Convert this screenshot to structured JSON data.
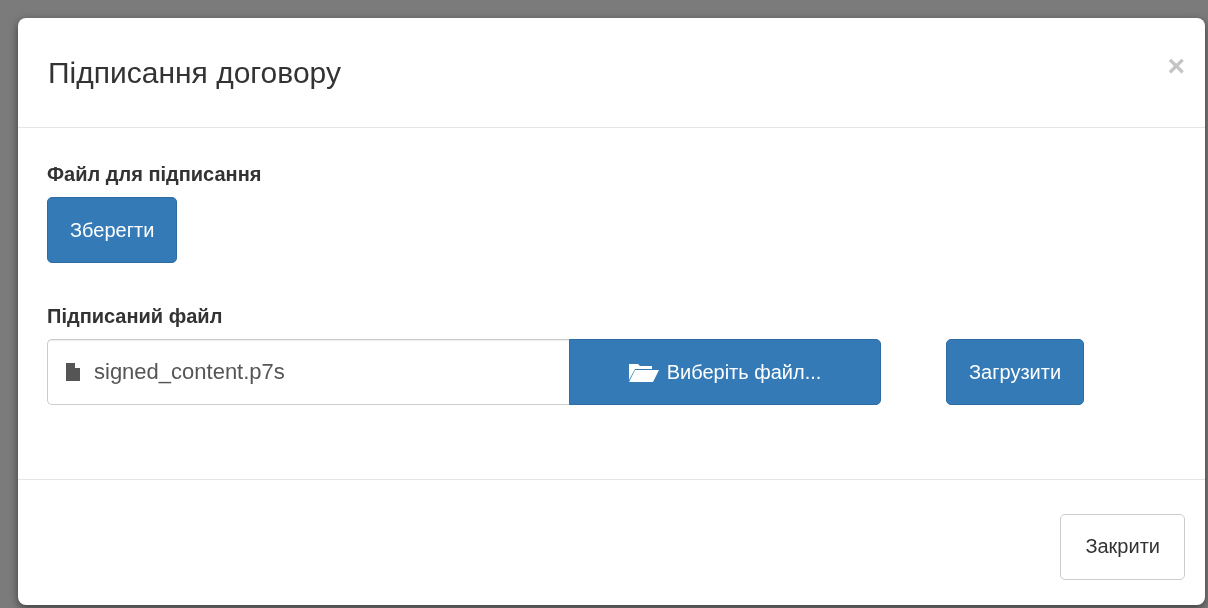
{
  "dialog": {
    "title": "Підписання договору",
    "close": "×",
    "file_to_sign": {
      "label": "Файл для підписання",
      "button": "Зберегти"
    },
    "signed_file": {
      "label": "Підписаний файл",
      "value": "signed_content.p7s",
      "browse": "Виберіть файл...",
      "upload": "Загрузити"
    },
    "footer_button": "Закрити"
  }
}
